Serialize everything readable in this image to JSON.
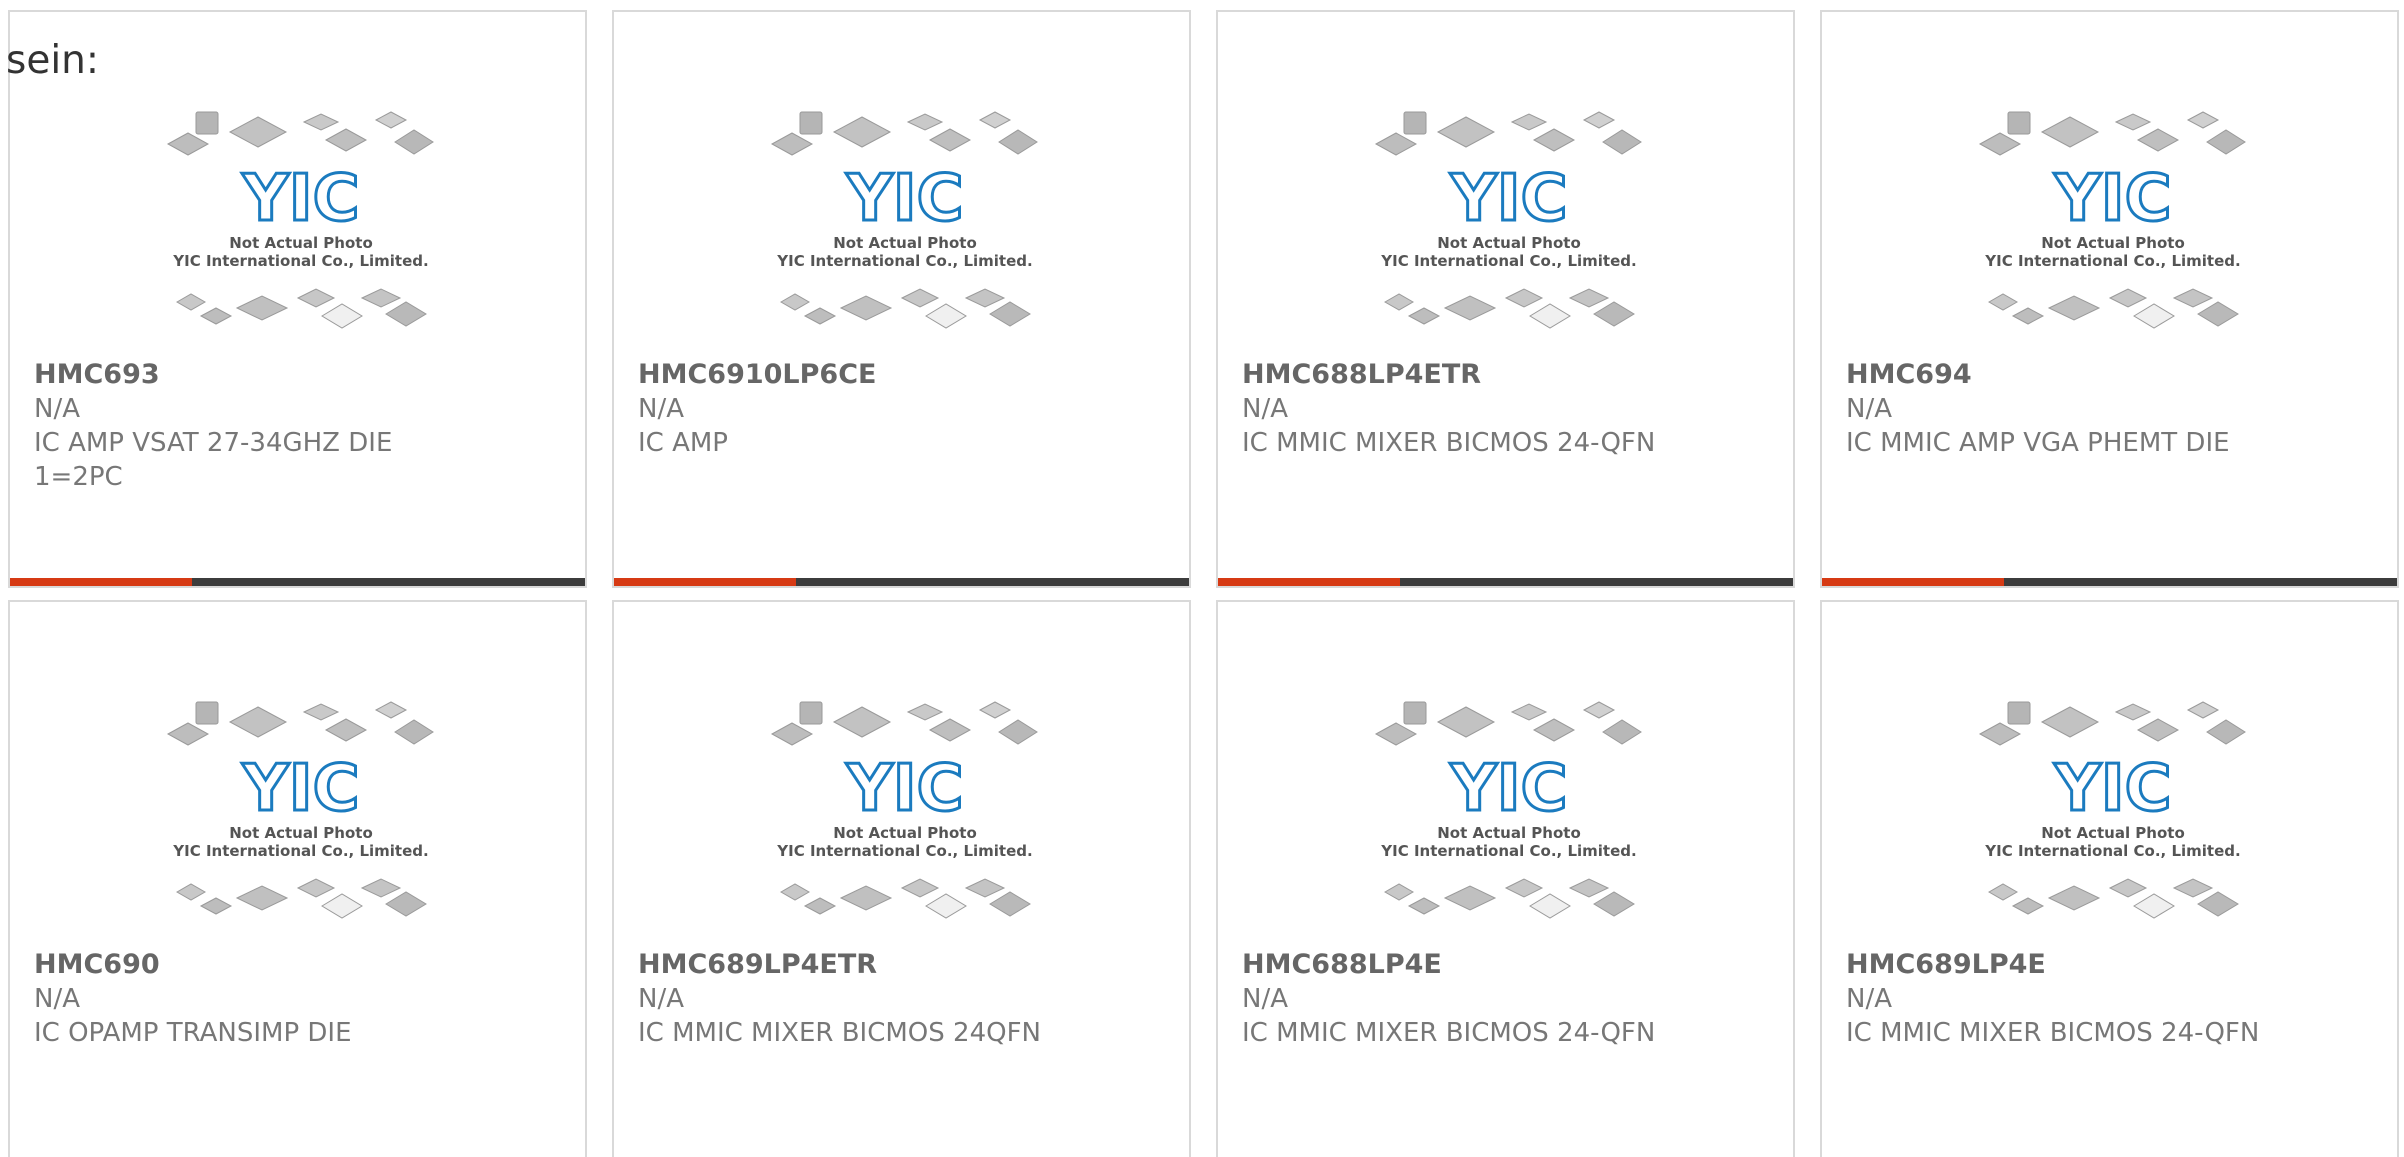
{
  "intro": {
    "text": "sein:"
  },
  "photo_caption": {
    "line1": "Not Actual Photo",
    "line2": "YIC International Co., Limited.",
    "logo_text": "YIC"
  },
  "colors": {
    "accent": "#d63a14",
    "bar": "#3c3c3c",
    "logo_blue": "#1b7bbf"
  },
  "products": [
    {
      "pn": "HMC693",
      "stock": "N/A",
      "desc": "IC AMP VSAT 27-34GHZ DIE",
      "extra": "1=2PC"
    },
    {
      "pn": "HMC6910LP6CE",
      "stock": "N/A",
      "desc": "IC AMP",
      "extra": ""
    },
    {
      "pn": "HMC688LP4ETR",
      "stock": "N/A",
      "desc": "IC MMIC MIXER BICMOS 24-QFN",
      "extra": ""
    },
    {
      "pn": "HMC694",
      "stock": "N/A",
      "desc": "IC MMIC AMP VGA PHEMT DIE",
      "extra": ""
    },
    {
      "pn": "HMC690",
      "stock": "N/A",
      "desc": "IC OPAMP TRANSIMP DIE",
      "extra": ""
    },
    {
      "pn": "HMC689LP4ETR",
      "stock": "N/A",
      "desc": "IC MMIC MIXER BICMOS 24QFN",
      "extra": ""
    },
    {
      "pn": "HMC688LP4E",
      "stock": "N/A",
      "desc": "IC MMIC MIXER BICMOS 24-QFN",
      "extra": ""
    },
    {
      "pn": "HMC689LP4E",
      "stock": "N/A",
      "desc": "IC MMIC MIXER BICMOS 24-QFN",
      "extra": ""
    }
  ]
}
